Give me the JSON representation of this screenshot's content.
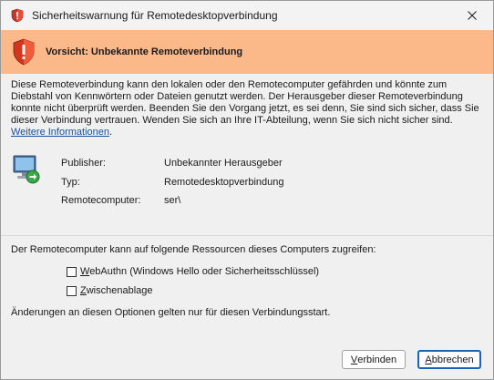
{
  "window": {
    "title": "Sicherheitswarnung für Remotedesktopverbindung"
  },
  "banner": {
    "title": "Vorsicht: Unbekannte Remoteverbindung",
    "icon": "shield-warning-icon",
    "background": "#fbb989"
  },
  "description": {
    "text": "Diese Remoteverbindung kann den lokalen oder den Remotecomputer gefährden und könnte zum\nDiebstahl von Kennwörtern oder Dateien genutzt werden. Der Herausgeber dieser Remoteverbindung\nkonnte nicht überprüft werden. Beenden Sie den Vorgang jetzt, es sei denn, Sie sind sich sicher, dass Sie\ndieser Verbindung vertrauen. Wenden Sie sich an Ihre IT-Abteilung, wenn Sie sich nicht sicher sind.\n",
    "link": "Weitere Informationen",
    "link_suffix": "."
  },
  "info": {
    "icon": "remote-desktop-icon",
    "rows": [
      {
        "label": "Publisher:",
        "value": "Unbekannter Herausgeber"
      },
      {
        "label": "Typ:",
        "value": "Remotedesktopverbindung"
      },
      {
        "label": "Remotecomputer:",
        "value": "ser\\"
      }
    ]
  },
  "resources": {
    "intro": "Der Remotecomputer kann auf folgende Ressourcen dieses Computers zugreifen:",
    "options": [
      {
        "accel": "W",
        "rest": "ebAuthn (Windows Hello oder Sicherheitsschlüssel)",
        "checked": false
      },
      {
        "accel": "Z",
        "rest": "wischenablage",
        "checked": false
      }
    ],
    "note": "Änderungen an diesen Optionen gelten nur für diesen Verbindungsstart."
  },
  "buttons": {
    "connect": {
      "accel": "V",
      "rest": "erbinden"
    },
    "cancel": {
      "accel": "A",
      "rest": "bbrechen"
    }
  },
  "colors": {
    "accent": "#1a64b8",
    "link": "#1a4f9c"
  }
}
